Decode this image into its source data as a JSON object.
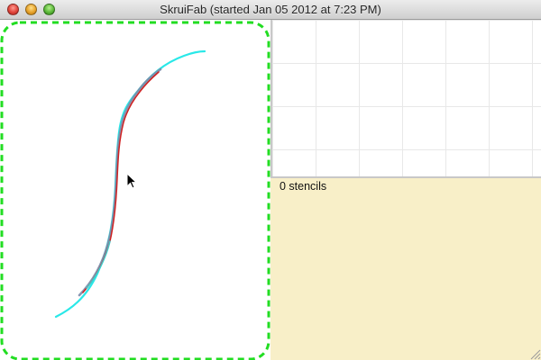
{
  "window": {
    "title": "SkruiFab (started Jan 05 2012 at 7:23 PM)"
  },
  "right_panel": {
    "stencil_count": "0 stencils"
  }
}
